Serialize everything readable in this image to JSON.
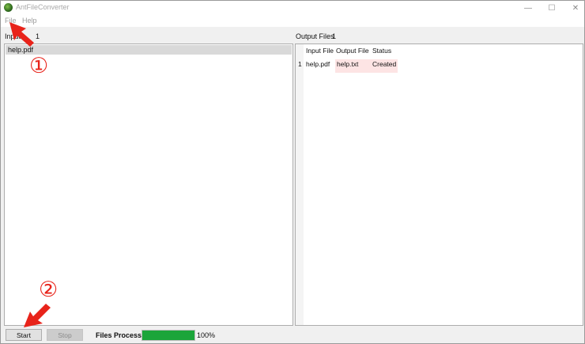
{
  "window": {
    "title": "AntFileConverter",
    "controls": {
      "minimize": "—",
      "maximize": "☐",
      "close": "✕"
    }
  },
  "menu": {
    "file": "File",
    "help": "Help"
  },
  "input_panel": {
    "label": "Input",
    "count": "1",
    "items": [
      "help.pdf"
    ]
  },
  "output_panel": {
    "label": "Output Files",
    "count": "1",
    "columns": [
      "Input File",
      "Output File",
      "Status"
    ],
    "rows": [
      {
        "index": "1",
        "input": "help.pdf",
        "output": "help.txt",
        "status": "Created"
      }
    ]
  },
  "footer": {
    "start_label": "Start",
    "stop_label": "Stop",
    "files_processed_label": "Files Processed",
    "progress_text": "100%",
    "progress_fraction": 1.0
  },
  "annotations": {
    "marker_1": "①",
    "marker_2": "②",
    "color": "#e8231a"
  },
  "colors": {
    "progress": "#1ba53a",
    "output_highlight": "#fde4e4"
  }
}
